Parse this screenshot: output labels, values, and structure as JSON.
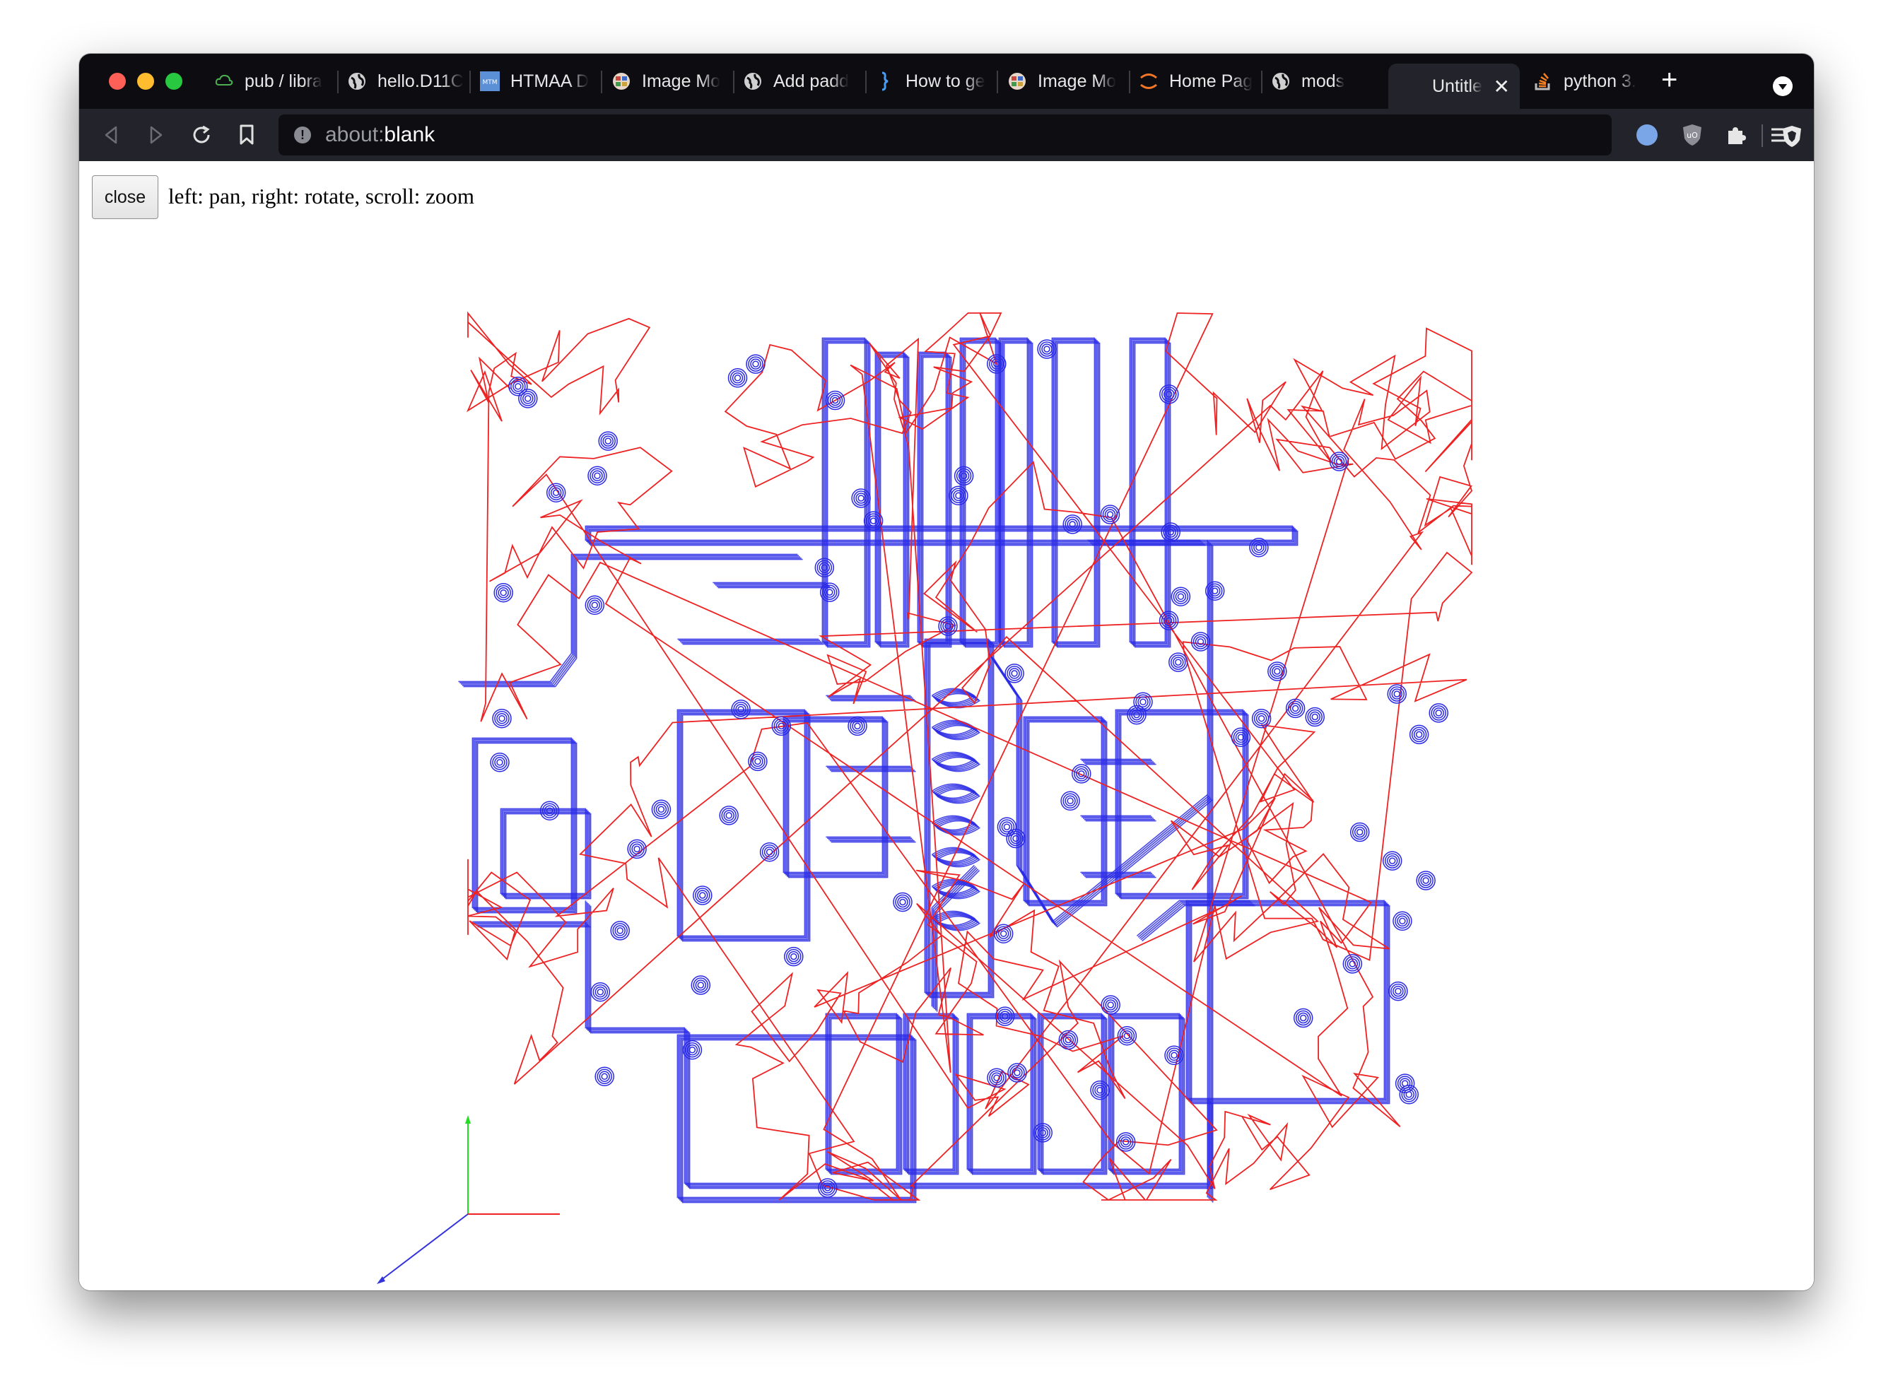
{
  "window": {
    "tabs": [
      {
        "label": "pub / libra",
        "icon": "cloud-icon"
      },
      {
        "label": "hello.D11C",
        "icon": "globe-icon"
      },
      {
        "label": "HTMAA D",
        "icon": "mtm-icon"
      },
      {
        "label": "Image Mo",
        "icon": "mods-icon"
      },
      {
        "label": "Add padd",
        "icon": "globe-icon"
      },
      {
        "label": "How to ge",
        "icon": "brace-icon"
      },
      {
        "label": "Image Mo",
        "icon": "mods-icon"
      },
      {
        "label": "Home Pag",
        "icon": "jupyter-icon"
      },
      {
        "label": "mods",
        "icon": "globe-icon"
      },
      {
        "label": "Untitle",
        "icon": "none",
        "active": true
      },
      {
        "label": "python 3.",
        "icon": "stackoverflow-icon"
      }
    ],
    "address": {
      "scheme": "about:",
      "host": "blank"
    },
    "colors": {
      "toolpath": "#ee2222",
      "traces": "#2a2ae6",
      "axis_x": "#ee2222",
      "axis_y": "#22dd22",
      "axis_z": "#3333dd"
    }
  },
  "page": {
    "close_label": "close",
    "hint": "left: pan, right: rotate, scroll: zoom"
  }
}
